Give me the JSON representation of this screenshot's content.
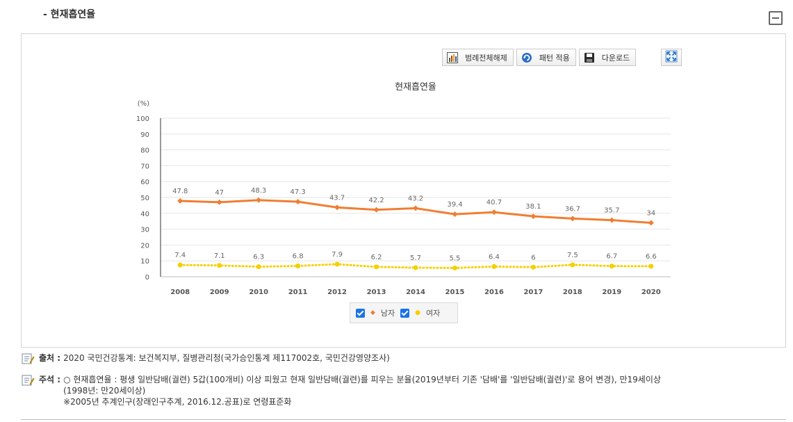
{
  "section": {
    "title": "- 현재흡연율"
  },
  "toolbar": {
    "legend_all_off": "범례전체해제",
    "pattern_apply": "패턴 적용",
    "download": "다운로드"
  },
  "icons": {
    "collapse": "minus-square-icon",
    "legend_all_off": "bar-chart-icon",
    "pattern_apply": "refresh-icon",
    "download": "floppy-disk-icon",
    "expand": "fullscreen-icon",
    "note": "notebook-icon"
  },
  "chart_data": {
    "type": "line",
    "title": "현재흡연율",
    "ylabel": "(%)",
    "xlabel": "",
    "ylim": [
      0,
      100
    ],
    "yticks": [
      0,
      10,
      20,
      30,
      40,
      50,
      60,
      70,
      80,
      90,
      100
    ],
    "categories": [
      "2008",
      "2009",
      "2010",
      "2011",
      "2012",
      "2013",
      "2014",
      "2015",
      "2016",
      "2017",
      "2018",
      "2019",
      "2020"
    ],
    "series": [
      {
        "name": "남자",
        "color": "#f07e31",
        "values": [
          47.8,
          47,
          48.3,
          47.3,
          43.7,
          42.2,
          43.2,
          39.4,
          40.7,
          38.1,
          36.7,
          35.7,
          34
        ]
      },
      {
        "name": "여자",
        "color": "#f5d000",
        "values": [
          7.4,
          7.1,
          6.3,
          6.8,
          7.9,
          6.2,
          5.7,
          5.5,
          6.4,
          6,
          7.5,
          6.7,
          6.6
        ]
      }
    ],
    "grid": true,
    "legend_position": "bottom-center"
  },
  "notes": {
    "source_label": "출처 :",
    "source_text": "2020 국민건강통계: 보건복지부, 질병관리청(국가승인통계 제117002호, 국민건강영양조사)",
    "remark_label": "주석 :",
    "remark_line1": "○ 현재흡연율 : 평생 일반담배(궐련) 5갑(100개비) 이상 피웠고 현재 일반담배(궐련)를 피우는 분율(2019년부터 기존 '담배'를 '일반담배(궐련)'로 용어 변경), 만19세이상",
    "remark_line2": "(1998년: 만20세이상)",
    "remark_line3": "※2005년 추계인구(장래인구추계, 2016.12.공표)로 연령표준화"
  }
}
